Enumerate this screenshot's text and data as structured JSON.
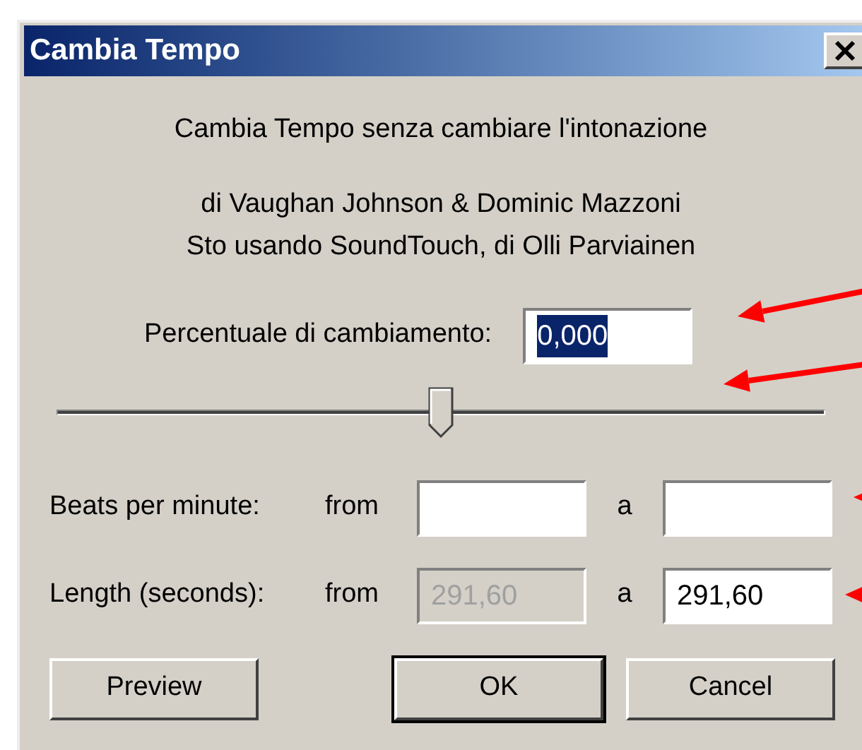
{
  "window": {
    "title": "Cambia Tempo"
  },
  "description": [
    "Cambia Tempo senza cambiare l'intonazione",
    "di Vaughan Johnson & Dominic Mazzoni",
    "Sto usando SoundTouch, di Olli Parviainen"
  ],
  "percent": {
    "label": "Percentuale di cambiamento:",
    "value": "0,000",
    "selected": true
  },
  "slider": {
    "level": 0.5
  },
  "rows": [
    {
      "label": "Beats per minute:",
      "from_label": "from",
      "from_value": "",
      "from_disabled": false,
      "to_label": "a",
      "to_value": ""
    },
    {
      "label": "Length (seconds):",
      "from_label": "from",
      "from_value": "291,60",
      "from_disabled": true,
      "to_label": "a",
      "to_value": "291,60"
    }
  ],
  "buttons": [
    {
      "label": "Preview",
      "default": false
    },
    {
      "label": "OK",
      "default": true
    },
    {
      "label": "Cancel",
      "default": false
    }
  ]
}
